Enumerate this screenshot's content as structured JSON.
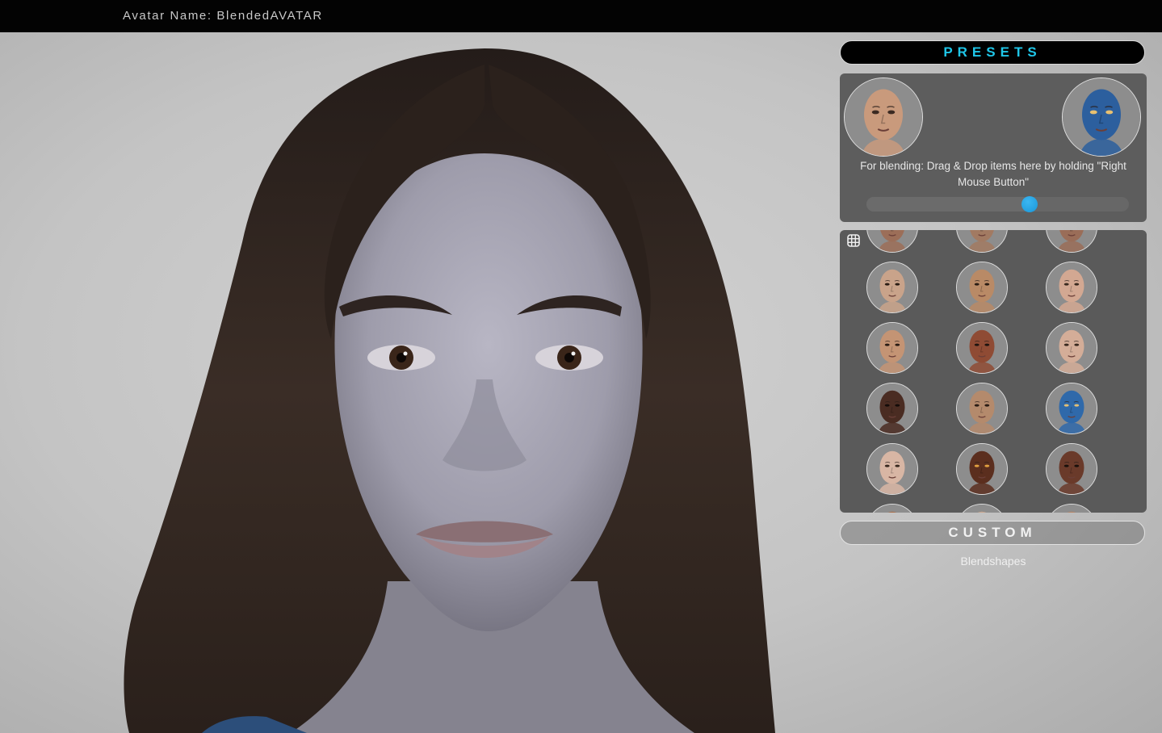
{
  "header": {
    "avatar_name": "Avatar Name: BlendedAVATAR"
  },
  "presets": {
    "label": "PRESETS",
    "color": "#1fc6e8"
  },
  "blend": {
    "hint": "For blending: Drag & Drop items here by holding \"Right Mouse Button\"",
    "slider_value": 0.62,
    "slider_color": "#1a96d8",
    "left_slot": {
      "skin": "#c99a7c",
      "eyes": "#3b2a22"
    },
    "right_slot": {
      "skin": "#2c5f9e",
      "eyes": "#e8c070"
    }
  },
  "grid": {
    "icon": "grid-icon",
    "faces": [
      {
        "skin": "#9c6e58",
        "eyes": "#2d1e16"
      },
      {
        "skin": "#a27a62",
        "eyes": "#2d1e16"
      },
      {
        "skin": "#9a6d58",
        "eyes": "#2d1e16"
      },
      {
        "skin": "#c9a38a",
        "eyes": "#2a1c14"
      },
      {
        "skin": "#b98a66",
        "eyes": "#2a1c14"
      },
      {
        "skin": "#d3a892",
        "eyes": "#3a2a20"
      },
      {
        "skin": "#c49474",
        "eyes": "#2a1c14"
      },
      {
        "skin": "#8f4b34",
        "eyes": "#1f140f"
      },
      {
        "skin": "#d4ad98",
        "eyes": "#3a2a20"
      },
      {
        "skin": "#4a2c22",
        "eyes": "#140c09"
      },
      {
        "skin": "#b48a6c",
        "eyes": "#2a1c14"
      },
      {
        "skin": "#2f69aa",
        "eyes": "#e3bf74"
      },
      {
        "skin": "#d8b6a4",
        "eyes": "#3a2a20"
      },
      {
        "skin": "#5b2e1e",
        "eyes": "#e0a040"
      },
      {
        "skin": "#6a3a2a",
        "eyes": "#1a100b"
      },
      {
        "skin": "#a8704e",
        "eyes": "#2a1c14"
      },
      {
        "skin": "#c9a48c",
        "eyes": "#2a1c14"
      },
      {
        "skin": "#b58466",
        "eyes": "#2a1c14"
      }
    ]
  },
  "custom": {
    "label": "CUSTOM",
    "blendshapes_label": "Blendshapes"
  }
}
